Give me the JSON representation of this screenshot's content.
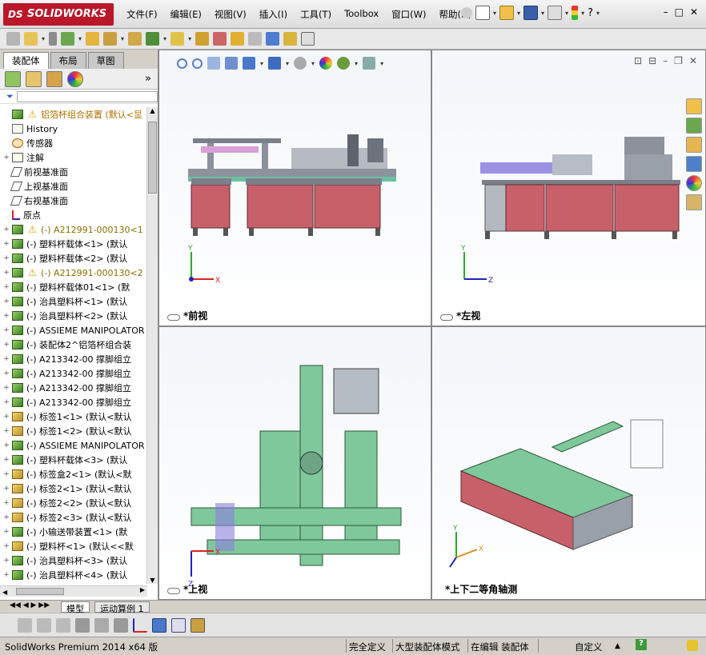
{
  "app": {
    "brand": "SOLIDWORKS",
    "brand_prefix": "DS"
  },
  "menu": [
    "文件(F)",
    "编辑(E)",
    "视图(V)",
    "插入(I)",
    "工具(T)",
    "Toolbox",
    "窗口(W)",
    "帮助(H)"
  ],
  "window_controls": [
    "–",
    "□",
    "✕"
  ],
  "left_panel": {
    "tabs": [
      "装配体",
      "布局",
      "草图"
    ],
    "active_tab": "装配体",
    "expand_arrow": "»",
    "tree": [
      {
        "icon": "asm",
        "warn": true,
        "label": "铝箔杯组合装置 (默认<显",
        "root": true,
        "exp": ""
      },
      {
        "icon": "hist",
        "label": "History",
        "exp": ""
      },
      {
        "icon": "sens",
        "label": "传感器",
        "exp": ""
      },
      {
        "icon": "annot",
        "label": "注解",
        "exp": "+"
      },
      {
        "icon": "plane",
        "label": "前视基准面",
        "exp": ""
      },
      {
        "icon": "plane",
        "label": "上视基准面",
        "exp": ""
      },
      {
        "icon": "plane",
        "label": "右视基准面",
        "exp": ""
      },
      {
        "icon": "origin",
        "label": "原点",
        "exp": ""
      },
      {
        "icon": "asm",
        "warn": true,
        "label": "(-) A212991-000130<1",
        "exp": "+",
        "warnlbl": true
      },
      {
        "icon": "asm",
        "label": "(-) 塑料杯载体<1> (默认",
        "exp": "+"
      },
      {
        "icon": "asm",
        "label": "(-) 塑料杯载体<2> (默认",
        "exp": "+"
      },
      {
        "icon": "asm",
        "warn": true,
        "label": "(-) A212991-000130<2",
        "exp": "+",
        "warnlbl": true
      },
      {
        "icon": "asm",
        "label": "(-) 塑料杯载体01<1> (默",
        "exp": "+"
      },
      {
        "icon": "asm",
        "label": "(-) 治具塑料杯<1> (默认",
        "exp": "+"
      },
      {
        "icon": "asm",
        "label": "(-) 治具塑料杯<2> (默认",
        "exp": "+"
      },
      {
        "icon": "asm",
        "label": "(-) ASSIEME MANIPOLATOR",
        "exp": "+"
      },
      {
        "icon": "asm",
        "label": "(-) 装配体2^铝箔杯组合装",
        "exp": "+"
      },
      {
        "icon": "asm",
        "label": "(-) A213342-00 撑脚组立",
        "exp": "+"
      },
      {
        "icon": "asm",
        "label": "(-) A213342-00 撑脚组立",
        "exp": "+"
      },
      {
        "icon": "asm",
        "label": "(-) A213342-00 撑脚组立",
        "exp": "+"
      },
      {
        "icon": "asm",
        "label": "(-) A213342-00 撑脚组立",
        "exp": "+"
      },
      {
        "icon": "part",
        "label": "(-) 标签1<1> (默认<默认",
        "exp": "+"
      },
      {
        "icon": "part",
        "label": "(-) 标签1<2> (默认<默认",
        "exp": "+"
      },
      {
        "icon": "asm",
        "label": "(-) ASSIEME MANIPOLATOR",
        "exp": "+"
      },
      {
        "icon": "asm",
        "label": "(-) 塑料杯载体<3> (默认",
        "exp": "+"
      },
      {
        "icon": "part",
        "label": "(-) 标签盒2<1> (默认<默",
        "exp": "+"
      },
      {
        "icon": "part",
        "label": "(-) 标签2<1> (默认<默认",
        "exp": "+"
      },
      {
        "icon": "part",
        "label": "(-) 标签2<2> (默认<默认",
        "exp": "+"
      },
      {
        "icon": "part",
        "label": "(-) 标签2<3> (默认<默认",
        "exp": "+"
      },
      {
        "icon": "asm",
        "label": "(-) 小输送带装置<1> (默",
        "exp": "+"
      },
      {
        "icon": "part",
        "label": "(-) 塑料杯<1> (默认<<默",
        "exp": "+"
      },
      {
        "icon": "asm",
        "label": "(-) 治具塑料杯<3> (默认",
        "exp": "+"
      },
      {
        "icon": "asm",
        "label": "(-) 治具塑料杯<4> (默认",
        "exp": "+"
      }
    ]
  },
  "viewports": {
    "front": "*前视",
    "left": "*左视",
    "top": "*上视",
    "iso": "*上下二等角轴测"
  },
  "bottom_tabs": [
    "模型",
    "运动算例 1"
  ],
  "status": {
    "product": "SolidWorks Premium 2014 x64 版",
    "fully_defined": "完全定义",
    "large_asm": "大型装配体模式",
    "editing": "在编辑 装配体",
    "custom": "自定义",
    "help": "?"
  },
  "colors": {
    "machine_red": "#c8606a",
    "machine_green": "#7fc89b",
    "frame_gray": "#7a7f8a",
    "brand_red": "#b8182a"
  }
}
